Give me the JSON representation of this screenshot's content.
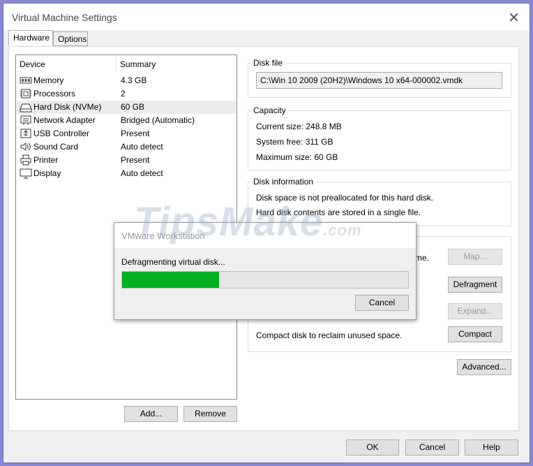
{
  "window": {
    "title": "Virtual Machine Settings",
    "close_label": "✕"
  },
  "tabs": [
    {
      "label": "Hardware"
    },
    {
      "label": "Options"
    }
  ],
  "device_list": {
    "col_device": "Device",
    "col_summary": "Summary",
    "items": [
      {
        "name": "Memory",
        "summary": "4.3 GB",
        "icon": "memory-icon"
      },
      {
        "name": "Processors",
        "summary": "2",
        "icon": "processor-icon"
      },
      {
        "name": "Hard Disk (NVMe)",
        "summary": "60 GB",
        "icon": "hard-disk-icon"
      },
      {
        "name": "Network Adapter",
        "summary": "Bridged (Automatic)",
        "icon": "network-adapter-icon"
      },
      {
        "name": "USB Controller",
        "summary": "Present",
        "icon": "usb-icon"
      },
      {
        "name": "Sound Card",
        "summary": "Auto detect",
        "icon": "speaker-icon"
      },
      {
        "name": "Printer",
        "summary": "Present",
        "icon": "printer-icon"
      },
      {
        "name": "Display",
        "summary": "Auto detect",
        "icon": "monitor-icon"
      }
    ],
    "selected": "Hard Disk (NVMe)"
  },
  "buttons": {
    "add": "Add...",
    "remove": "Remove",
    "ok": "OK",
    "cancel": "Cancel",
    "help": "Help"
  },
  "disk_file": {
    "label": "Disk file",
    "path": "C:\\Win 10 2009 (20H2)\\Windows 10 x64-000002.vmdk"
  },
  "capacity": {
    "label": "Capacity",
    "current": "Current size:  248.8 MB",
    "free": "System free:  311 GB",
    "maximum": "Maximum size:  60 GB"
  },
  "disk_info": {
    "label": "Disk information",
    "line1": "Disk space is not preallocated for this hard disk.",
    "line2": "Hard disk contents are stored in a single file."
  },
  "utilities": {
    "map_text_tail": "me.",
    "map_button": "Map...",
    "defrag_text_tail": ".",
    "defrag_button": "Defragment",
    "expand_button": "Expand...",
    "compact_text": "Compact disk to reclaim unused space.",
    "compact_button": "Compact",
    "advanced_button": "Advanced..."
  },
  "dialog": {
    "title": "VMware Workstation",
    "message": "Defragmenting virtual disk...",
    "progress": 0.34,
    "cancel": "Cancel"
  },
  "watermark": {
    "main": "TipsMake",
    "suffix": ".com"
  },
  "colors": {
    "progress_fill": "#06b025",
    "frame": "#8a86d6"
  }
}
